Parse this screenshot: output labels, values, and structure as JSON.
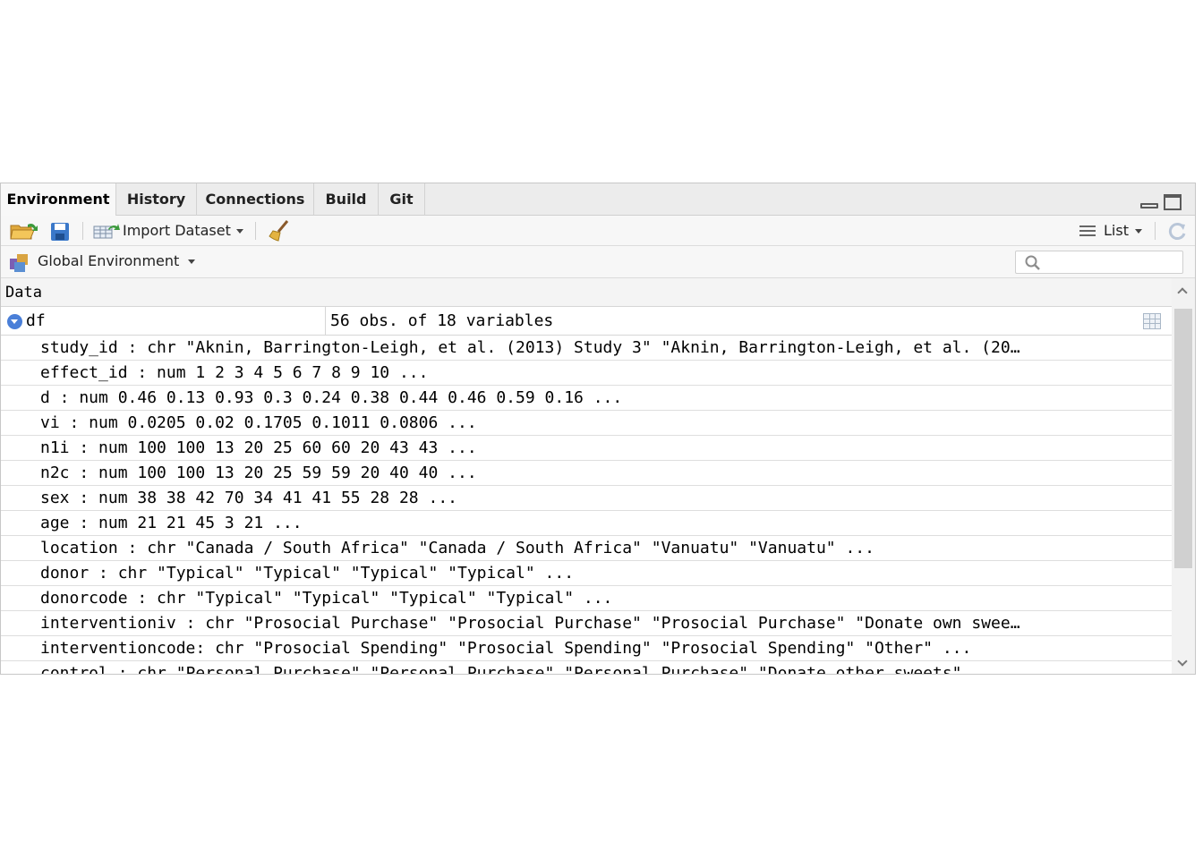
{
  "tabs": [
    {
      "label": "Environment"
    },
    {
      "label": "History"
    },
    {
      "label": "Connections"
    },
    {
      "label": "Build"
    },
    {
      "label": "Git"
    }
  ],
  "toolbar": {
    "import_label": "Import Dataset",
    "view_label": "List"
  },
  "env": {
    "selector_label": "Global Environment"
  },
  "data": {
    "section_label": "Data",
    "object": {
      "name": "df",
      "value": "56 obs. of 18 variables"
    },
    "variables": [
      "study_id : chr \"Aknin, Barrington-Leigh, et al. (2013) Study 3\" \"Aknin, Barrington-Leigh, et al. (20…",
      "effect_id : num 1 2 3 4 5 6 7 8 9 10 ...",
      "d : num 0.46 0.13 0.93 0.3 0.24 0.38 0.44 0.46 0.59 0.16 ...",
      "vi : num 0.0205 0.02 0.1705 0.1011 0.0806 ...",
      "n1i : num 100 100 13 20 25 60 60 20 43 43 ...",
      "n2c : num 100 100 13 20 25 59 59 20 40 40 ...",
      "sex : num 38 38 42 70 34 41 41 55 28 28 ...",
      "age : num 21 21 45 3 21 ...",
      "location : chr \"Canada / South Africa\" \"Canada / South Africa\" \"Vanuatu\" \"Vanuatu\" ...",
      "donor : chr \"Typical\" \"Typical\" \"Typical\" \"Typical\" ...",
      "donorcode : chr \"Typical\" \"Typical\" \"Typical\" \"Typical\" ...",
      "interventioniv : chr \"Prosocial Purchase\" \"Prosocial Purchase\" \"Prosocial Purchase\" \"Donate own swee…",
      "interventioncode: chr \"Prosocial Spending\" \"Prosocial Spending\" \"Prosocial Spending\" \"Other\" ...",
      "control : chr \"Personal Purchase\" \"Personal Purchase\" \"Personal Purchase\" \"Donate other sweets\" ..."
    ]
  },
  "icons": {
    "open": "folder-open-icon",
    "save": "save-icon",
    "import": "table-import-icon",
    "clear": "broom-icon",
    "list": "list-icon",
    "refresh": "refresh-icon",
    "env": "environment-icon",
    "search": "search-icon",
    "expand": "expand-icon",
    "grid": "grid-view-icon"
  },
  "colors": {
    "accent": "#4a7fd8",
    "tabbar_bg": "#ececec",
    "toolbar_bg": "#f7f7f7"
  }
}
